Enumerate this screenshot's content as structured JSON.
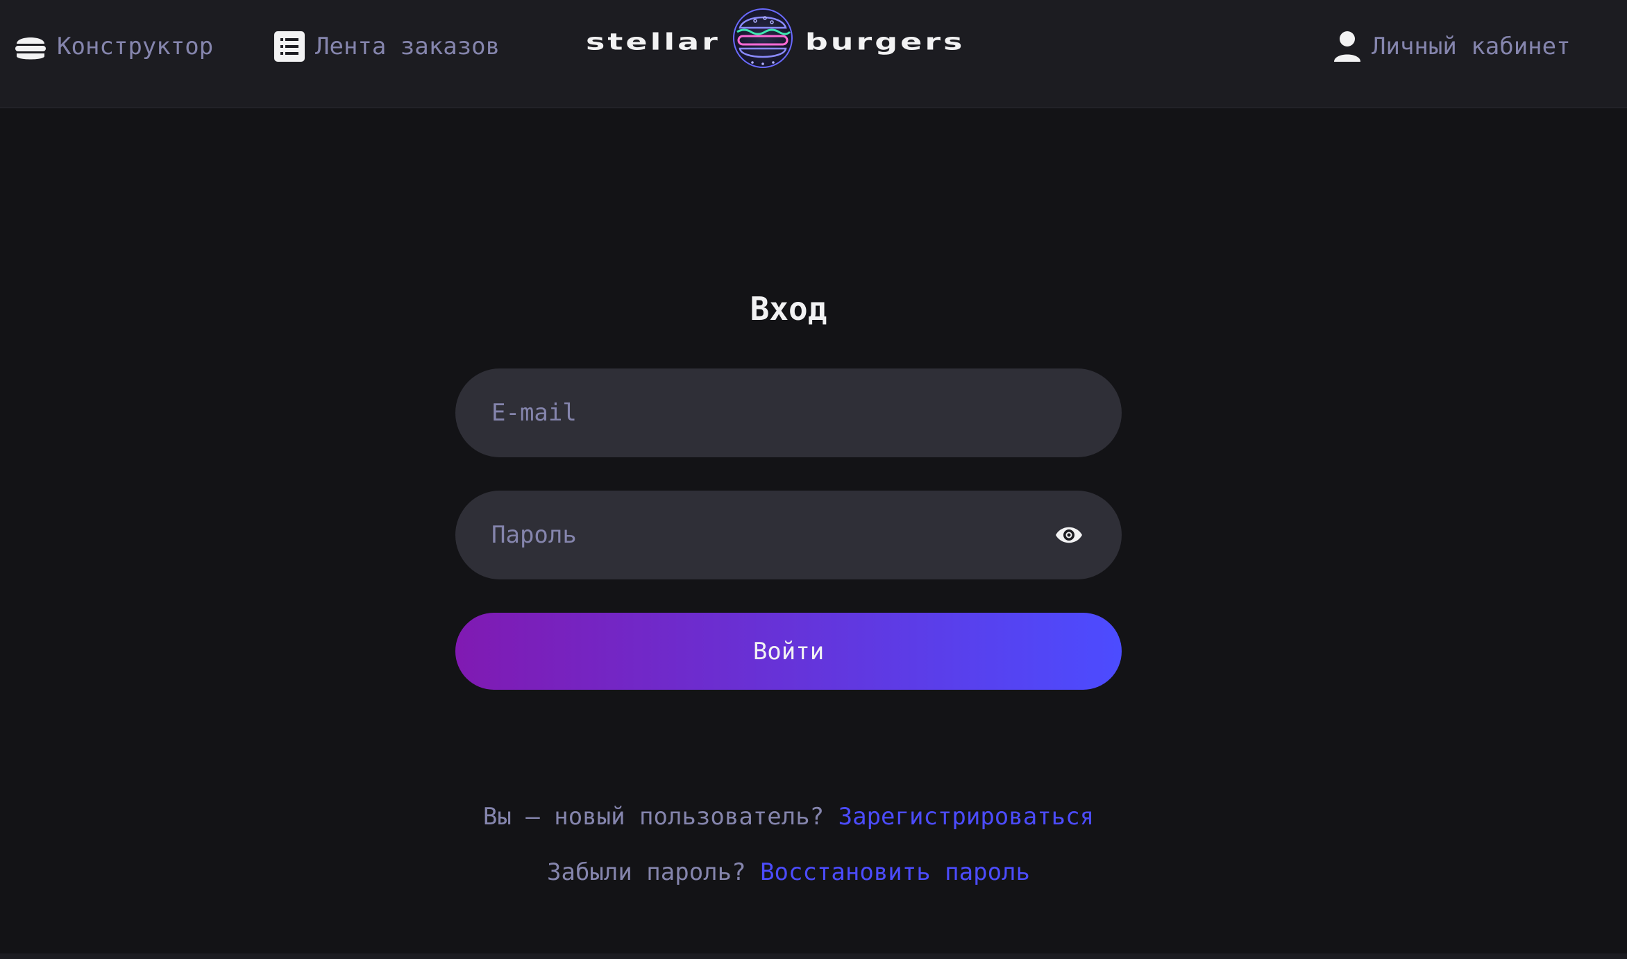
{
  "header": {
    "nav": {
      "constructor": "Конструктор",
      "feed": "Лента заказов",
      "account": "Личный кабинет"
    },
    "logo": {
      "word_left": "stellar",
      "word_right": "burgers"
    }
  },
  "login": {
    "title": "Вход",
    "email_placeholder": "E-mail",
    "password_placeholder": "Пароль",
    "submit_label": "Войти",
    "register_prompt": "Вы — новый пользователь?",
    "register_link": "Зарегистрироваться",
    "forgot_prompt": "Забыли пароль?",
    "forgot_link": "Восстановить пароль"
  },
  "colors": {
    "accent": "#4c4cff",
    "accent_start": "#801ab2",
    "inactive_text": "#8585ad",
    "background": "#131316",
    "header_background": "#1c1c21",
    "input_background": "#2f2f37"
  },
  "icons": {
    "constructor": "burger-icon",
    "feed": "list-icon",
    "account": "profile-icon",
    "password_toggle": "eye-icon"
  }
}
